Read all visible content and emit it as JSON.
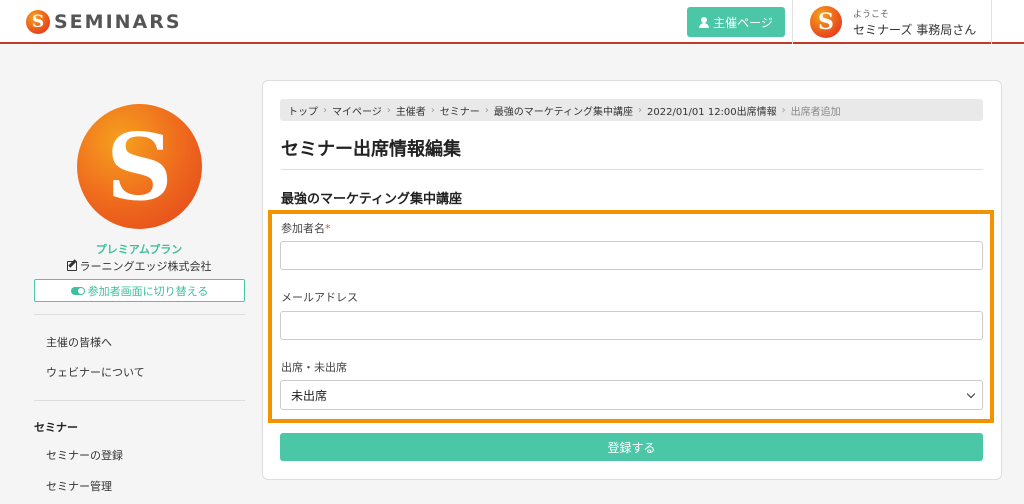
{
  "header": {
    "logo_letter": "S",
    "logo_text": "SEMINARS",
    "host_button": "主催ページ",
    "welcome": "ようこそ",
    "user_name": "セミナーズ 事務局さん"
  },
  "sidebar": {
    "avatar_letter": "S",
    "plan": "プレミアムプラン",
    "company": "ラーニングエッジ株式会社",
    "switch_button": "参加者画面に切り替える",
    "links_top": [
      "主催の皆様へ",
      "ウェビナーについて"
    ],
    "section_heading": "セミナー",
    "links_seminar": [
      "セミナーの登録",
      "セミナー管理"
    ]
  },
  "breadcrumb": {
    "items": [
      "トップ",
      "マイページ",
      "主催者",
      "セミナー",
      "最強のマーケティング集中講座",
      "2022/01/01 12:00出席情報"
    ],
    "current": "出席者追加"
  },
  "main": {
    "page_title": "セミナー出席情報編集",
    "seminar_name": "最強のマーケティング集中講座",
    "form": {
      "name_label": "参加者名",
      "required_mark": "*",
      "name_value": "",
      "email_label": "メールアドレス",
      "email_value": "",
      "attendance_label": "出席・未出席",
      "attendance_selected": "未出席"
    },
    "submit_label": "登録する"
  },
  "colors": {
    "accent": "#4bc7a8",
    "header_rule": "#c0392b",
    "highlight": "#f29400"
  }
}
